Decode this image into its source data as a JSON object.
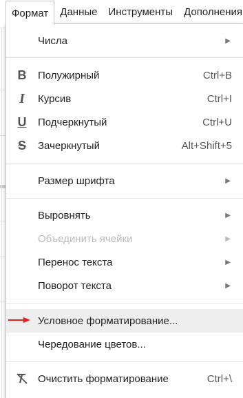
{
  "menubar": {
    "items": [
      {
        "label": "Формат"
      },
      {
        "label": "Данные"
      },
      {
        "label": "Инструменты"
      },
      {
        "label": "Дополнения"
      }
    ]
  },
  "menu": {
    "numbers": {
      "label": "Числа",
      "icon": "chevron-right-icon"
    },
    "bold": {
      "label": "Полужирный",
      "shortcut": "Ctrl+B",
      "icon": "bold-icon"
    },
    "italic": {
      "label": "Курсив",
      "shortcut": "Ctrl+I",
      "icon": "italic-icon"
    },
    "underline": {
      "label": "Подчеркнутый",
      "shortcut": "Ctrl+U",
      "icon": "underline-icon"
    },
    "strikethrough": {
      "label": "Зачеркнутый",
      "shortcut": "Alt+Shift+5",
      "icon": "strikethrough-icon"
    },
    "font_size": {
      "label": "Размер шрифта"
    },
    "align": {
      "label": "Выровнять"
    },
    "merge_cells": {
      "label": "Объединить ячейки",
      "disabled": true
    },
    "text_wrap": {
      "label": "Перенос текста"
    },
    "text_rotation": {
      "label": "Поворот текста"
    },
    "conditional_formatting": {
      "label": "Условное форматирование...",
      "highlighted": true
    },
    "alternating_colors": {
      "label": "Чередование цветов..."
    },
    "clear_formatting": {
      "label": "Очистить форматирование",
      "shortcut": "Ctrl+\\",
      "icon": "clear-formatting-icon"
    }
  },
  "colors": {
    "annotation_arrow": "#e02020",
    "highlight": "#eeeeee",
    "disabled_text": "#bbbbbb"
  }
}
